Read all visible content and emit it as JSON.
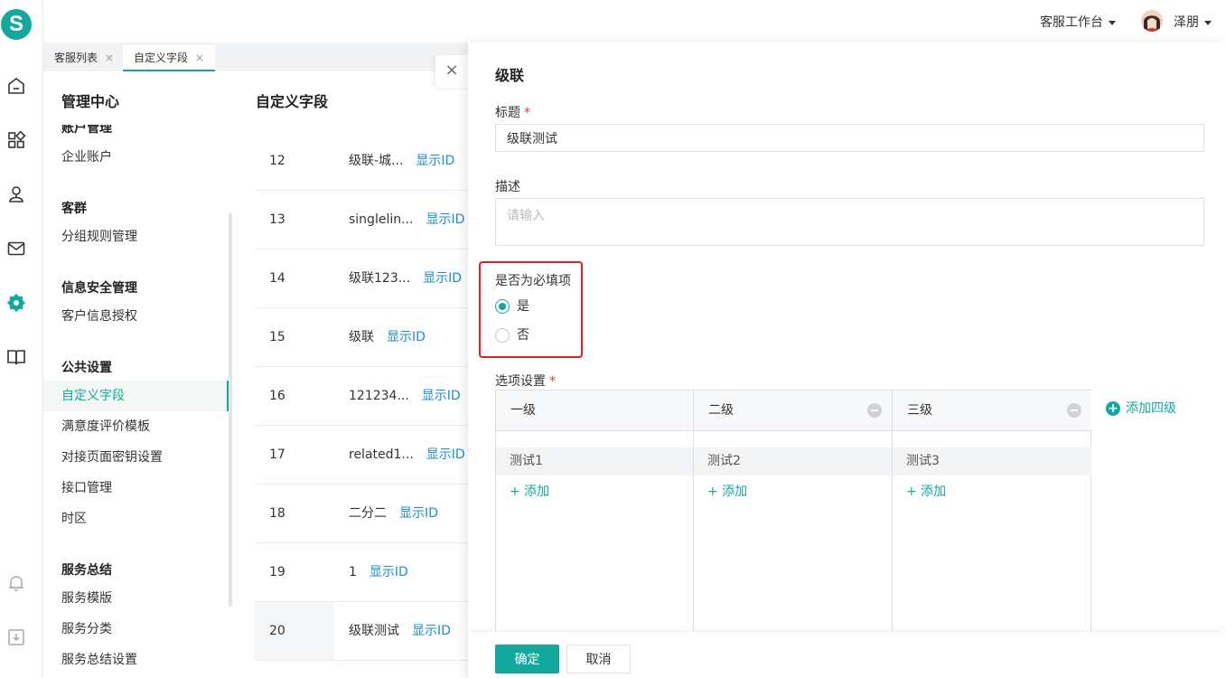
{
  "app": {
    "logo_letter": "S",
    "accent_color": "#13a89e",
    "link_color": "#1a8fcf"
  },
  "rail": {
    "icons": [
      "home-icon",
      "apps-icon",
      "customers-icon",
      "mail-icon",
      "settings-icon",
      "book-icon",
      "bell-icon",
      "download-icon"
    ],
    "active": "settings-icon"
  },
  "topbar": {
    "workspace": "客服工作台",
    "user_name": "泽朋"
  },
  "tabs": [
    {
      "label": "客服列表",
      "close": "×"
    },
    {
      "label": "自定义字段",
      "close": "×"
    }
  ],
  "sidebar": {
    "title": "管理中心",
    "cut_heading": "账户管理",
    "groups": [
      {
        "heading": "",
        "items": [
          "企业账户"
        ]
      },
      {
        "heading": "客群",
        "items": [
          "分组规则管理"
        ]
      },
      {
        "heading": "信息安全管理",
        "items": [
          "客户信息授权"
        ]
      },
      {
        "heading": "公共设置",
        "items": [
          "自定义字段",
          "满意度评价模板",
          "对接页面密钥设置",
          "接口管理",
          "时区"
        ]
      },
      {
        "heading": "服务总结",
        "items": [
          "服务模版",
          "服务分类",
          "服务总结设置"
        ]
      }
    ],
    "active_item": "自定义字段"
  },
  "list": {
    "title": "自定义字段",
    "link_label": "显示ID",
    "rows": [
      {
        "num": "12",
        "name": "级联-城..."
      },
      {
        "num": "13",
        "name": "singlelin..."
      },
      {
        "num": "14",
        "name": "级联123..."
      },
      {
        "num": "15",
        "name": "级联"
      },
      {
        "num": "16",
        "name": "121234..."
      },
      {
        "num": "17",
        "name": "related1..."
      },
      {
        "num": "18",
        "name": "二分二"
      },
      {
        "num": "19",
        "name": "1"
      },
      {
        "num": "20",
        "name": "级联测试"
      }
    ],
    "selected_num": "20",
    "close_label": "×"
  },
  "drawer": {
    "title": "级联",
    "title_label": "标题",
    "title_value": "级联测试",
    "desc_label": "描述",
    "desc_placeholder": "请输入",
    "required_label": "是否为必填项",
    "required_star": "*",
    "options": [
      {
        "label": "是",
        "checked": true
      },
      {
        "label": "否",
        "checked": false
      }
    ],
    "option_settings_label": "选项设置",
    "levels": [
      {
        "name": "一级",
        "removable": false,
        "item": "测试1"
      },
      {
        "name": "二级",
        "removable": true,
        "item": "测试2"
      },
      {
        "name": "三级",
        "removable": true,
        "item": "测试3"
      }
    ],
    "add_label": "+ 添加",
    "add_level_label": "添加四级",
    "ok_label": "确定",
    "cancel_label": "取消"
  }
}
